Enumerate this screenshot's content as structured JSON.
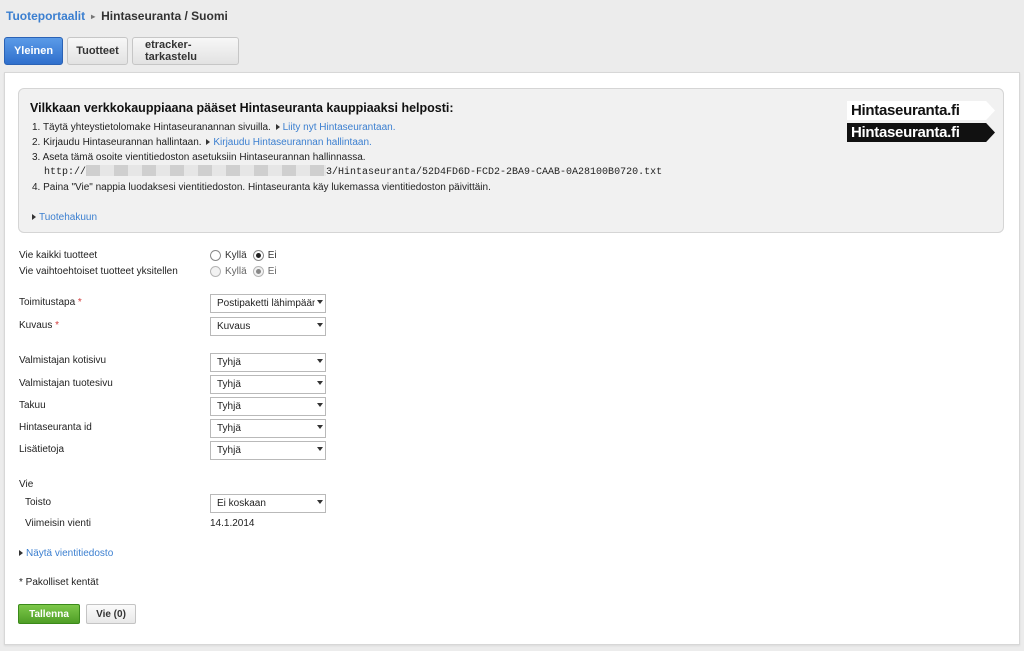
{
  "breadcrumb": {
    "root": "Tuoteportaalit",
    "separator": "▸",
    "current": "Hintaseuranta / Suomi"
  },
  "tabs": [
    {
      "label": "Yleinen",
      "active": true
    },
    {
      "label": "Tuotteet",
      "active": false
    },
    {
      "label": "etracker-tarkastelu",
      "active": false
    }
  ],
  "info": {
    "title": "Vilkkaan verkkokauppiaana pääset Hintaseuranta kauppiaaksi helposti:",
    "step1_text": "1. Täytä yhteystietolomake Hintaseuranannan sivuilla.",
    "step1_link": "Liity nyt Hintaseurantaan.",
    "step2_text": "2. Kirjaudu Hintaseurannan hallintaan.",
    "step2_link": "Kirjaudu Hintaseurannan hallintaan.",
    "step3_text": "3. Aseta tämä osoite vientitiedoston asetuksiin Hintaseurannan hallinnassa.",
    "url_prefix": "http://",
    "url_suffix": "3/Hintaseuranta/52D4FD6D-FCD2-2BA9-CAAB-0A28100B0720.txt",
    "step4_text": "4. Paina \"Vie\" nappia luodaksesi vientitiedoston. Hintaseuranta käy lukemassa vientitiedoston päivittäin.",
    "search_link": "Tuotehakuun",
    "logo_top": "Hintaseuranta.fi",
    "logo_bottom": "Hintaseuranta.fi"
  },
  "form": {
    "export_all": {
      "label": "Vie kaikki tuotteet",
      "yes": "Kyllä",
      "no": "Ei",
      "selected": "Ei"
    },
    "export_variants": {
      "label": "Vie vaihtoehtoiset tuotteet yksitellen",
      "yes": "Kyllä",
      "no": "Ei",
      "selected": "Ei"
    },
    "delivery": {
      "label": "Toimitustapa",
      "required_mark": "*",
      "value": "Postipaketti lähimpään"
    },
    "description": {
      "label": "Kuvaus",
      "required_mark": "*",
      "value": "Kuvaus"
    },
    "manufacturer_home": {
      "label": "Valmistajan kotisivu",
      "value": "Tyhjä"
    },
    "manufacturer_product": {
      "label": "Valmistajan tuotesivu",
      "value": "Tyhjä"
    },
    "warranty": {
      "label": "Takuu",
      "value": "Tyhjä"
    },
    "hintaseuranta_id": {
      "label": "Hintaseuranta id",
      "value": "Tyhjä"
    },
    "extra_info": {
      "label": "Lisätietoja",
      "value": "Tyhjä"
    },
    "export_section": "Vie",
    "repeat": {
      "label": "Toisto",
      "value": "Ei koskaan"
    },
    "last_export": {
      "label": "Viimeisin vienti",
      "value": "14.1.2014"
    },
    "show_file_link": "Näytä vientitiedosto",
    "required_note": "* Pakolliset kentät"
  },
  "actions": {
    "save_label": "Tallenna",
    "export_label": "Vie (0)"
  },
  "colors": {
    "link": "#3b7fd0",
    "save_button": "#5aa82f",
    "active_tab": "#3a7bd5",
    "required": "#d23c3c"
  }
}
